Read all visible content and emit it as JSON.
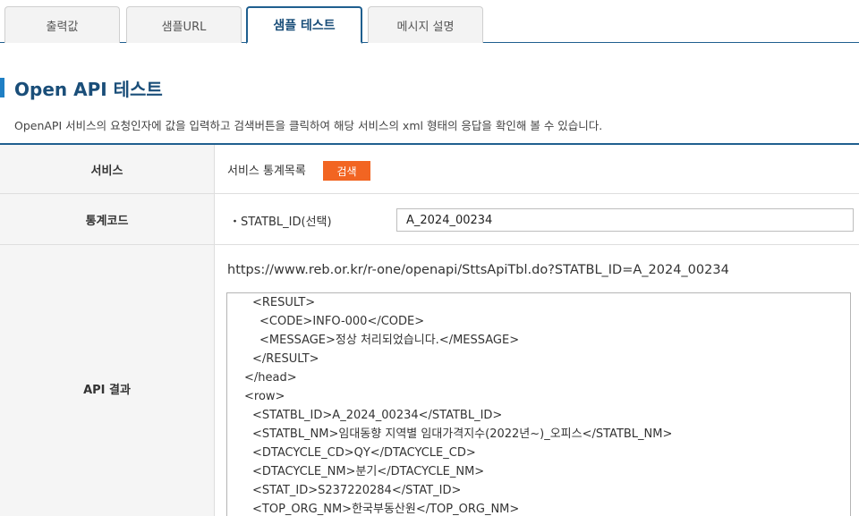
{
  "tabs": [
    {
      "label": "출력값"
    },
    {
      "label": "샘플URL"
    },
    {
      "label": "샘플 테스트"
    },
    {
      "label": "메시지 설명"
    }
  ],
  "page": {
    "title": "Open API 테스트",
    "description": "OpenAPI 서비스의 요청인자에 값을 입력하고 검색버튼을 클릭하여 해당 서비스의 xml 형태의 응답을 확인해 볼 수 있습니다."
  },
  "form": {
    "service_header": "서비스",
    "service_value": "서비스 통계목록",
    "search_label": "검색",
    "code_header": "통계코드",
    "param_label": "・STATBL_ID(선택)",
    "param_value": "A_2024_00234",
    "result_header": "API 결과"
  },
  "result": {
    "url": "https://www.reb.or.kr/r-one/openapi/SttsApiTbl.do?STATBL_ID=A_2024_00234",
    "lines": [
      "<RESULT>",
      "<CODE>INFO-000</CODE>",
      "<MESSAGE>정상 처리되었습니다.</MESSAGE>",
      "</RESULT>",
      "</head>",
      "<row>",
      "<STATBL_ID>A_2024_00234</STATBL_ID>",
      "<STATBL_NM>임대동향 지역별 임대가격지수(2022년~)_오피스</STATBL_NM>",
      "<DTACYCLE_CD>QY</DTACYCLE_CD>",
      "<DTACYCLE_NM>분기</DTACYCLE_NM>",
      "<STAT_ID>S237220284</STAT_ID>",
      "<TOP_ORG_NM>한국부동산원</TOP_ORG_NM>"
    ]
  }
}
